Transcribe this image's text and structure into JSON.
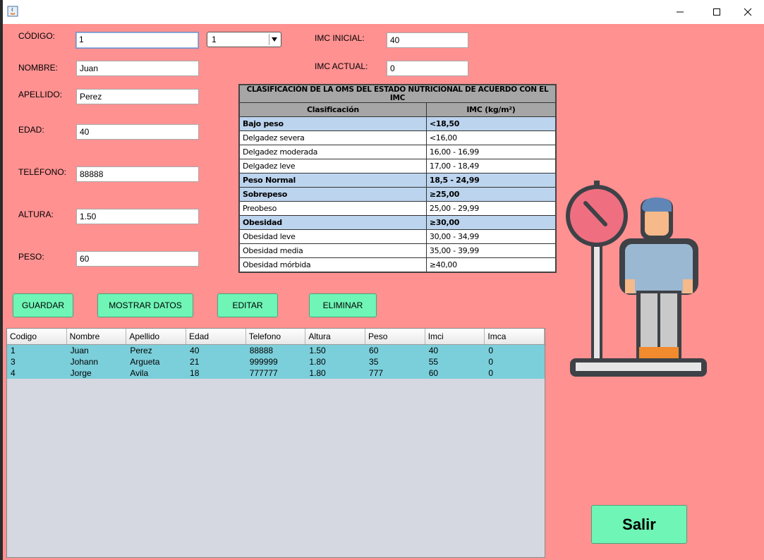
{
  "window": {
    "controls": {
      "minimize": "—",
      "maximize": "☐",
      "close": "✕"
    }
  },
  "form": {
    "codigo": {
      "label": "CÓDIGO:",
      "value": "1"
    },
    "combo": {
      "value": "1"
    },
    "nombre": {
      "label": "NOMBRE:",
      "value": "Juan"
    },
    "apellido": {
      "label": "APELLIDO:",
      "value": "Perez"
    },
    "edad": {
      "label": "EDAD:",
      "value": "40"
    },
    "telefono": {
      "label": "TELÉFONO:",
      "value": "88888"
    },
    "altura": {
      "label": "ALTURA:",
      "value": "1.50"
    },
    "peso": {
      "label": "PESO:",
      "value": "60"
    },
    "imc_inicial": {
      "label": "IMC INICIAL:",
      "value": "40"
    },
    "imc_actual": {
      "label": "IMC ACTUAL:",
      "value": "0"
    }
  },
  "imc_table": {
    "caption": "CLASIFICACIÓN DE LA OMS DEL ESTADO NUTRICIONAL DE ACUERDO CON EL IMC",
    "headers": [
      "Clasificación",
      "IMC (kg/m²)"
    ],
    "rows": [
      {
        "c": "Bajo peso",
        "v": "<18,50",
        "hl": true
      },
      {
        "c": "Delgadez severa",
        "v": "<16,00",
        "hl": false
      },
      {
        "c": "Delgadez moderada",
        "v": "16,00 - 16,99",
        "hl": false
      },
      {
        "c": "Delgadez leve",
        "v": "17,00 - 18,49",
        "hl": false
      },
      {
        "c": "Peso Normal",
        "v": "18,5 - 24,99",
        "hl": true
      },
      {
        "c": "Sobrepeso",
        "v": "≥25,00",
        "hl": true
      },
      {
        "c": "Preobeso",
        "v": "25,00 - 29,99",
        "hl": false
      },
      {
        "c": "Obesidad",
        "v": "≥30,00",
        "hl": true
      },
      {
        "c": "Obesidad leve",
        "v": "30,00 - 34,99",
        "hl": false
      },
      {
        "c": "Obesidad media",
        "v": "35,00 - 39,99",
        "hl": false
      },
      {
        "c": "Obesidad mórbida",
        "v": "≥40,00",
        "hl": false
      }
    ]
  },
  "buttons": {
    "guardar": "GUARDAR",
    "mostrar": "MOSTRAR DATOS",
    "editar": "EDITAR",
    "eliminar": "ELIMINAR",
    "salir": "Salir"
  },
  "grid": {
    "columns": [
      "Codigo",
      "Nombre",
      "Apellido",
      "Edad",
      "Telefono",
      "Altura",
      "Peso",
      "Imci",
      "Imca"
    ],
    "rows": [
      [
        "1",
        "Juan",
        "Perez",
        "40",
        "88888",
        "1.50",
        "60",
        "40",
        "0"
      ],
      [
        "3",
        "Johann",
        "Argueta",
        "21",
        "999999",
        "1.80",
        "35",
        "55",
        "0"
      ],
      [
        "4",
        "Jorge",
        "Avila",
        "18",
        "777777",
        "1.80",
        "777",
        "60",
        "0"
      ]
    ]
  },
  "colors": {
    "background": "#ff9191",
    "button": "#6ff5b6",
    "row_selected": "#7bcfda"
  }
}
